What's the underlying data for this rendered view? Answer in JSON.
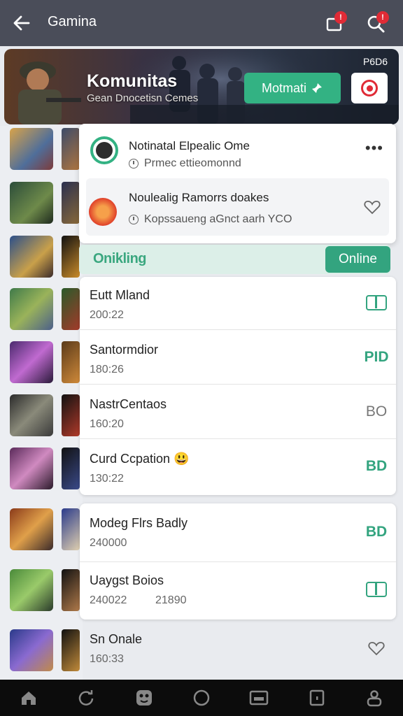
{
  "header": {
    "title": "Gamina",
    "notif_badge": "!",
    "search_badge": "!"
  },
  "banner": {
    "title": "Komunitas",
    "subtitle": "Gean Dnocetisn Cemes",
    "code": "P6D6",
    "monitor_label": "Motmati"
  },
  "notifications": [
    {
      "title": "Notinatal Elpealic Ome",
      "meta": "Prmec ettieomonnd"
    },
    {
      "title": "Noulealig  Ramorrs doakes",
      "meta": "Kopssaueng aGnct aarh YCO"
    }
  ],
  "section": {
    "label": "Onikling",
    "online_label": "Online"
  },
  "list": [
    {
      "name": "Eutt Mland",
      "time": "200:22",
      "action": "box"
    },
    {
      "name": "Santormdior",
      "time": "180:26",
      "action": "PID"
    },
    {
      "name": "NastrCentaos",
      "time": "160:20",
      "action": "BO"
    },
    {
      "name": "Curd Ccpation",
      "emoji": "😃",
      "time": "130:22",
      "action": "BD"
    },
    {
      "name": "Modeg Flrs Badly",
      "time": "240000",
      "action": "BD"
    },
    {
      "name": "Uaygst Boios",
      "time": "240022",
      "time2": "21890",
      "action": "box"
    },
    {
      "name": "Sn Onale",
      "time": "160:33",
      "action": "heart"
    }
  ],
  "colors": {
    "accent": "#33a47f",
    "badge": "#e02b36",
    "topbar": "#4a4d59"
  },
  "nav": [
    "home-icon",
    "refresh-icon",
    "gamepad-icon",
    "circle-icon",
    "media-icon",
    "square-icon",
    "profile-icon"
  ]
}
